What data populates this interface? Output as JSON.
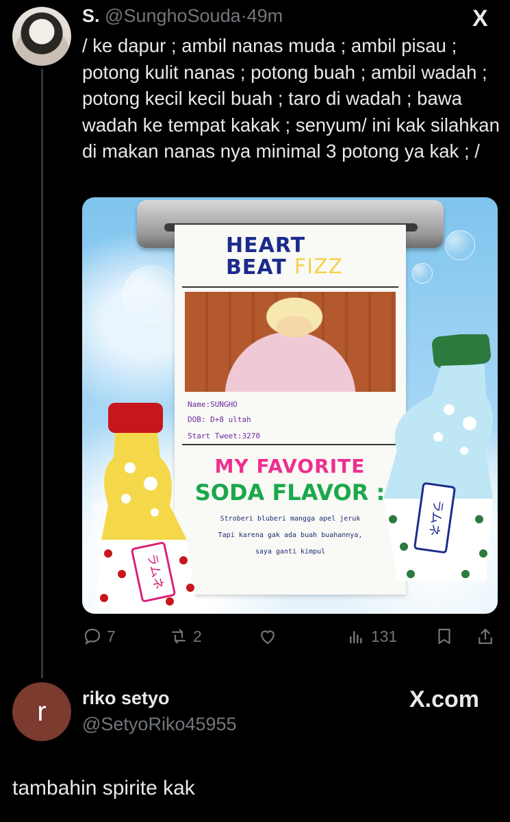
{
  "tweet": {
    "display_name": "S.",
    "handle": "@SunghoSouda",
    "separator": "·",
    "time": "49m",
    "platform_logo": "X",
    "text": "/ ke dapur ; ambil nanas muda ; ambil pisau ; potong kulit nanas ; potong buah ; ambil wadah ; potong kecil kecil buah ; taro di wadah ; bawa wadah ke tempat kakak ; senyum/ ini kak silahkan di makan nanas nya minimal 3 potong ya kak ; /"
  },
  "media": {
    "title_line1": "HEART",
    "title_line2": "BEAT",
    "title_accent": "FIZZ",
    "fields": [
      {
        "label": "Name",
        "value": ":SUNGHO"
      },
      {
        "label": "DOB",
        "value": ": D+8 ultah"
      },
      {
        "label": "Start Tweet",
        "value": ":3270"
      }
    ],
    "fav_line1": "MY FAVORITE",
    "fav_line2": "SODA FLAVOR :",
    "desc_lines": [
      "Stroberi bluberi mangga apel jeruk",
      "Tapi karena gak ada buah buahannya,",
      "saya ganti kimpul"
    ],
    "bottle_label_left": "ラムネ",
    "bottle_label_right": "ラムネ"
  },
  "actions": {
    "replies": "7",
    "reposts": "2",
    "views": "131"
  },
  "reply": {
    "avatar_letter": "r",
    "display_name": "riko setyo",
    "handle": "@SetyoRiko45955",
    "watermark": "X.com",
    "text": "tambahin spirite kak"
  },
  "colors": {
    "background": "#000000",
    "text": "#e7e9ea",
    "muted": "#71767b",
    "reply_avatar": "#7b3b2f"
  }
}
